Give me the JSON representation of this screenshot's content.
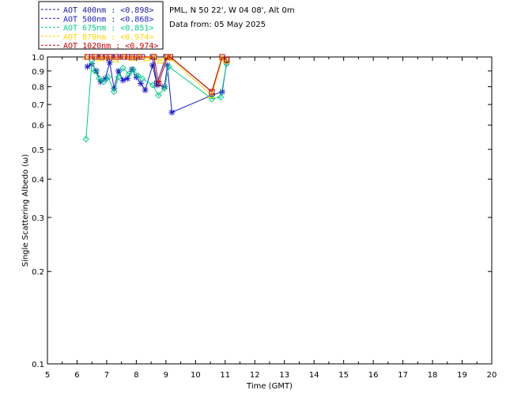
{
  "chart_data": {
    "type": "line",
    "title": "",
    "header_lines": [
      "PML, N 50 22', W 04 08', Alt 0m",
      "Data from: 05 May 2025"
    ],
    "xlabel": "Time (GMT)",
    "ylabel": "Single Scattering Albedo (ω)",
    "xlim": [
      5,
      20
    ],
    "ylim": [
      0.1,
      1.0
    ],
    "y_scale": "log",
    "x_ticks": [
      "5",
      "6",
      "7",
      "8",
      "9",
      "10",
      "11",
      "12",
      "13",
      "14",
      "15",
      "16",
      "17",
      "18",
      "19",
      "20"
    ],
    "y_ticks": [
      "0.1",
      "0.2",
      "0.3",
      "0.4",
      "0.5",
      "0.6",
      "0.7",
      "0.8",
      "0.9",
      "1.0"
    ],
    "legend_position": "top-left outside",
    "series": [
      {
        "name": "AOT  400nm : <0.898>",
        "color": "#1a1a9a",
        "marker": "square",
        "x": [
          6.35,
          6.5,
          6.65,
          6.8,
          7.0,
          7.15,
          7.3,
          7.55,
          7.75,
          7.85,
          8.0,
          8.2,
          8.55,
          8.7,
          9.0,
          9.15,
          10.55,
          10.9,
          11.05
        ],
        "y": [
          1.0,
          1.0,
          1.0,
          1.0,
          1.0,
          1.0,
          1.0,
          1.0,
          1.0,
          1.0,
          1.0,
          1.0,
          1.0,
          0.82,
          1.0,
          1.0,
          0.77,
          1.0,
          0.98
        ]
      },
      {
        "name": "AOT  500nm : <0.868>",
        "color": "#1a1acc",
        "marker": "star",
        "x": [
          6.35,
          6.5,
          6.65,
          6.8,
          6.95,
          7.1,
          7.25,
          7.4,
          7.55,
          7.7,
          7.85,
          8.0,
          8.15,
          8.3,
          8.55,
          8.7,
          8.95,
          9.05,
          9.2,
          10.55,
          10.9,
          11.05
        ],
        "y": [
          0.93,
          0.95,
          0.9,
          0.83,
          0.85,
          0.96,
          0.79,
          0.9,
          0.84,
          0.85,
          0.91,
          0.86,
          0.82,
          0.78,
          0.94,
          0.81,
          0.8,
          0.94,
          0.66,
          0.75,
          0.77,
          0.96
        ]
      },
      {
        "name": "AOT  675nm : <0.851>",
        "color": "#00cc88",
        "marker": "diamond",
        "x": [
          6.3,
          6.5,
          6.6,
          6.75,
          6.9,
          7.05,
          7.25,
          7.4,
          7.55,
          7.75,
          7.9,
          8.05,
          8.2,
          8.55,
          8.75,
          8.95,
          9.1,
          10.55,
          10.85,
          11.05
        ],
        "y": [
          0.54,
          0.97,
          0.9,
          0.85,
          0.83,
          0.86,
          0.77,
          0.86,
          0.92,
          0.88,
          0.91,
          0.87,
          0.85,
          0.81,
          0.75,
          0.79,
          0.93,
          0.73,
          0.74,
          0.95
        ]
      },
      {
        "name": "AOT  870nm : <0.974>",
        "color": "#ffd700",
        "marker": "triangle",
        "x": [
          6.3,
          6.55,
          6.8,
          7.05,
          7.3,
          7.6,
          7.85,
          8.1,
          8.35,
          8.6,
          8.8,
          9.0,
          9.15,
          10.55,
          10.9,
          11.05
        ],
        "y": [
          1.0,
          1.0,
          0.99,
          1.0,
          0.98,
          1.0,
          0.99,
          1.0,
          0.99,
          1.0,
          0.97,
          1.0,
          0.99,
          0.75,
          0.99,
          0.97
        ]
      },
      {
        "name": "AOT 1020nm : <0.974>",
        "color": "#cc0000",
        "marker": "square",
        "x": [
          6.35,
          6.6,
          6.85,
          7.1,
          7.35,
          7.6,
          7.85,
          8.1,
          8.6,
          8.75,
          9.05,
          9.15,
          10.55,
          10.9,
          11.05
        ],
        "y": [
          1.0,
          1.0,
          1.0,
          1.0,
          1.0,
          1.0,
          1.0,
          1.0,
          1.0,
          0.82,
          1.0,
          1.0,
          0.77,
          1.0,
          0.98
        ]
      }
    ]
  }
}
